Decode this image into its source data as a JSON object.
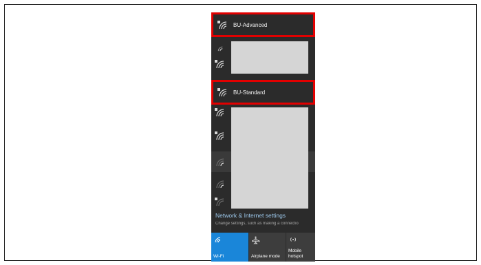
{
  "networks": {
    "advanced": {
      "name": "BU-Advanced",
      "icon": "wifi-secured-icon"
    },
    "standard": {
      "name": "BU-Standard",
      "icon": "wifi-secured-icon"
    }
  },
  "settings": {
    "title": "Network & Internet settings",
    "subtitle": "Change settings, such as making a connectio"
  },
  "tiles": {
    "wifi": {
      "label": "Wi-Fi",
      "icon": "wifi-icon",
      "active": true
    },
    "airplane": {
      "label": "Airplane mode",
      "icon": "airplane-icon"
    },
    "hotspot": {
      "label": "Mobile hotspot",
      "label_line1": "Mobile",
      "label_line2": "hotspot",
      "icon": "hotspot-icon"
    }
  },
  "colors": {
    "panel_bg": "#2b2b2b",
    "highlight_border": "#e20000",
    "active_tile": "#1a86d9",
    "link": "#9cc7ea",
    "redacted": "#d5d5d5"
  }
}
